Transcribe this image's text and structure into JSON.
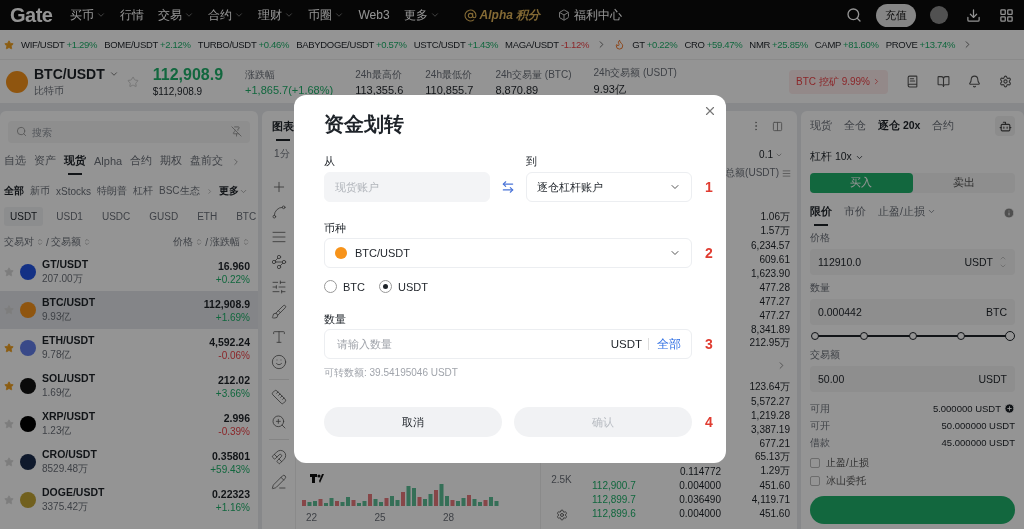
{
  "nav": {
    "logo": "Gate",
    "items": [
      {
        "label": "买币",
        "dropdown": true
      },
      {
        "label": "行情",
        "dropdown": false
      },
      {
        "label": "交易",
        "dropdown": true
      },
      {
        "label": "合约",
        "dropdown": true
      },
      {
        "label": "理财",
        "dropdown": true
      },
      {
        "label": "币圈",
        "dropdown": true
      },
      {
        "label": "Web3",
        "dropdown": false
      },
      {
        "label": "更多",
        "dropdown": true
      }
    ],
    "alpha": "Alpha 积分",
    "welfare": "福利中心",
    "deposit": "充值"
  },
  "ticker": {
    "groups": [
      [
        {
          "pair": "WIF/USDT",
          "change": "+1.29%",
          "rising": true
        },
        {
          "pair": "BOME/USDT",
          "change": "+2.12%",
          "rising": true
        },
        {
          "pair": "TURBO/USDT",
          "change": "+0.46%",
          "rising": true
        },
        {
          "pair": "BABYDOGE/USDT",
          "change": "+0.57%",
          "rising": true
        },
        {
          "pair": "USTC/USDT",
          "change": "+1.43%",
          "rising": true
        },
        {
          "pair": "MAGA/USDT",
          "change": "-1.12%",
          "rising": false
        }
      ],
      [
        {
          "pair": "GT",
          "change": "+0.22%",
          "rising": true
        },
        {
          "pair": "CRO",
          "change": "+59.47%",
          "rising": true
        },
        {
          "pair": "NMR",
          "change": "+25.85%",
          "rising": true
        },
        {
          "pair": "CAMP",
          "change": "+81.60%",
          "rising": true
        },
        {
          "pair": "PROVE",
          "change": "+13.74%",
          "rising": true
        }
      ]
    ]
  },
  "header": {
    "pair": "BTC/USDT",
    "name": "比特币",
    "price": "112,908.9",
    "price_usd": "$112,908.9",
    "stats": [
      {
        "label": "涨跌幅",
        "value": "+1,865.7(+1.68%)",
        "rising": true
      },
      {
        "label": "24h最高价",
        "value": "113,355.6"
      },
      {
        "label": "24h最低价",
        "value": "110,855.7"
      },
      {
        "label": "24h交易量 (BTC)",
        "value": "8,870.89"
      },
      {
        "label": "24h交易额 (USDT)",
        "value": "9.93亿"
      }
    ],
    "promo": "BTC 挖矿 9.99%"
  },
  "market": {
    "search": {
      "placeholder": "搜索"
    },
    "tabs": [
      {
        "label": "自选",
        "selected": false
      },
      {
        "label": "资产",
        "selected": false
      },
      {
        "label": "现货",
        "selected": true
      },
      {
        "label": "Alpha",
        "selected": false
      },
      {
        "label": "合约",
        "selected": false
      },
      {
        "label": "期权",
        "selected": false
      },
      {
        "label": "盘前交",
        "selected": false
      }
    ],
    "filters": [
      {
        "label": "全部",
        "selected": true
      },
      {
        "label": "新币",
        "selected": false
      },
      {
        "label": "xStocks",
        "selected": false
      },
      {
        "label": "特朗普",
        "selected": false
      },
      {
        "label": "杠杆",
        "selected": false
      },
      {
        "label": "BSC生态",
        "selected": false
      }
    ],
    "more": "更多",
    "quotes": [
      {
        "label": "USDT",
        "selected": true
      },
      {
        "label": "USD1",
        "selected": false
      },
      {
        "label": "USDC",
        "selected": false
      },
      {
        "label": "GUSD",
        "selected": false
      },
      {
        "label": "ETH",
        "selected": false
      },
      {
        "label": "BTC",
        "selected": false
      }
    ],
    "columns": {
      "left": [
        "交易对",
        "交易额"
      ],
      "right": [
        "价格",
        "涨跌幅"
      ],
      "separator": "/"
    },
    "rows": [
      {
        "pair": "GT/USDT",
        "volume": "207.00万",
        "price": "16.960",
        "change": "+0.22%",
        "rising": true,
        "favorite": false,
        "selected": false,
        "color": "#143185"
      },
      {
        "pair": "BTC/USDT",
        "volume": "9.93亿",
        "price": "112,908.9",
        "change": "+1.69%",
        "rising": true,
        "favorite": false,
        "selected": true,
        "color": "#8f550f"
      },
      {
        "pair": "ETH/USDT",
        "volume": "9.78亿",
        "price": "4,592.24",
        "change": "-0.06%",
        "rising": false,
        "favorite": true,
        "selected": false,
        "color": "#394988"
      },
      {
        "pair": "SOL/USDT",
        "volume": "1.69亿",
        "price": "212.02",
        "change": "+3.66%",
        "rising": true,
        "favorite": true,
        "selected": false,
        "color": "#0a0a0a"
      },
      {
        "pair": "XRP/USDT",
        "volume": "1.23亿",
        "price": "2.996",
        "change": "-0.39%",
        "rising": false,
        "favorite": false,
        "selected": false,
        "color": "#000000"
      },
      {
        "pair": "CRO/USDT",
        "volume": "8529.48万",
        "price": "0.35801",
        "change": "+59.43%",
        "rising": true,
        "favorite": false,
        "selected": false,
        "color": "#0f192c"
      },
      {
        "pair": "DOGE/USDT",
        "volume": "3375.42万",
        "price": "0.22323",
        "change": "+1.16%",
        "rising": true,
        "favorite": false,
        "selected": false,
        "color": "#71601e"
      }
    ]
  },
  "chart": {
    "tab": "图表",
    "interval": "1分",
    "volume_label": "2.5K",
    "x_labels": [
      "22",
      "25",
      "28"
    ]
  },
  "orderbook": {
    "precision": "0.1",
    "total_label": "总额(USDT)",
    "asks": [
      {
        "total": "1.06万"
      },
      {
        "total": "1.57万"
      },
      {
        "total": "6,234.57"
      },
      {
        "total": "609.61"
      },
      {
        "total": "1,623.90"
      },
      {
        "total": "477.28"
      },
      {
        "total": "477.27"
      },
      {
        "total": "477.27"
      },
      {
        "total": "8,341.89"
      },
      {
        "total": "212.95万"
      }
    ],
    "bids": [
      {
        "total": "123.64万"
      },
      {
        "total": "5,572.27"
      },
      {
        "total": "1,219.28"
      },
      {
        "total": "3,387.19"
      },
      {
        "total": "677.21"
      },
      {
        "total": "65.13万"
      },
      {
        "amount": "0.114772",
        "total": "1.29万"
      },
      {
        "price": "112,900.7",
        "amount": "0.004000",
        "total": "451.60"
      },
      {
        "price": "112,899.7",
        "amount": "0.036490",
        "total": "4,119.71"
      },
      {
        "price": "112,899.6",
        "amount": "0.004000",
        "total": "451.60"
      }
    ]
  },
  "trade": {
    "tabs": [
      {
        "label": "现货",
        "selected": false
      },
      {
        "label": "全仓",
        "selected": false
      },
      {
        "label": "逐仓 20x",
        "selected": true
      },
      {
        "label": "合约",
        "selected": false
      }
    ],
    "leverage": "杠杆 10x",
    "sides": [
      {
        "label": "买入",
        "selected": true
      },
      {
        "label": "卖出",
        "selected": false
      }
    ],
    "order_types": [
      {
        "label": "限价",
        "selected": true,
        "dropdown": false
      },
      {
        "label": "市价",
        "selected": false,
        "dropdown": false
      },
      {
        "label": "止盈/止损",
        "selected": false,
        "dropdown": true
      }
    ],
    "fields": [
      {
        "label": "价格",
        "value": "112910.0",
        "unit": "USDT",
        "stepper": true
      },
      {
        "label": "数量",
        "value": "0.000442",
        "unit": "BTC",
        "stepper": false
      }
    ],
    "slider": {
      "level": 1
    },
    "amount": {
      "label": "交易额",
      "value": "50.00",
      "unit": "USDT"
    },
    "balances": [
      {
        "label": "可用",
        "value": "5.000000 USDT",
        "add": true
      },
      {
        "label": "可开",
        "value": "50.000000 USDT",
        "add": false
      },
      {
        "label": "借款",
        "value": "45.000000 USDT",
        "add": false
      }
    ],
    "options": [
      {
        "label": "止盈/止损",
        "checked": false
      },
      {
        "label": "冰山委托",
        "checked": false
      }
    ]
  },
  "dialog": {
    "title": "资金划转",
    "from": {
      "label": "从",
      "value": "现货账户",
      "disabled": true
    },
    "to": {
      "label": "到",
      "value": "逐仓杠杆账户"
    },
    "currency": {
      "label": "币种",
      "value": "BTC/USDT",
      "color": "#f7931a"
    },
    "units": [
      {
        "label": "BTC",
        "selected": false
      },
      {
        "label": "USDT",
        "selected": true
      }
    ],
    "amount": {
      "label": "数量",
      "placeholder": "请输入数量",
      "unit": "USDT",
      "max": "全部"
    },
    "available": "可转数额: 39.54195046 USDT",
    "buttons": [
      {
        "label": "取消",
        "disabled": false
      },
      {
        "label": "确认",
        "disabled": true
      }
    ],
    "steps": [
      "1",
      "2",
      "3",
      "4"
    ]
  }
}
